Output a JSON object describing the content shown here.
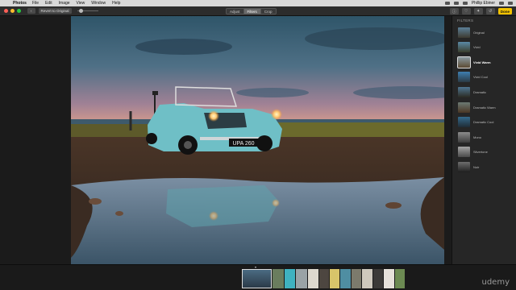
{
  "menubar": {
    "app": "Photos",
    "items": [
      "File",
      "Edit",
      "Image",
      "View",
      "Window",
      "Help"
    ],
    "user": "Phillip Ebiner"
  },
  "toolbar": {
    "revert_label": "Revert to Original",
    "tabs": [
      "Adjust",
      "Filters",
      "Crop"
    ],
    "active_tab": "Filters",
    "done_label": "Done"
  },
  "sidebar": {
    "title": "FILTERS",
    "filters": [
      {
        "label": "Original"
      },
      {
        "label": "Vivid"
      },
      {
        "label": "Vivid Warm"
      },
      {
        "label": "Vivid Cool"
      },
      {
        "label": "Dramatic"
      },
      {
        "label": "Dramatic Warm"
      },
      {
        "label": "Dramatic Cool"
      },
      {
        "label": "Mono"
      },
      {
        "label": "Silvertone"
      },
      {
        "label": "Noir"
      }
    ],
    "selected": "Vivid Warm"
  },
  "photo": {
    "license_plate": "UPA 260"
  },
  "watermark": "udemy",
  "colors": {
    "accent_done": "#f2c200",
    "car": "#6fbfc6"
  }
}
